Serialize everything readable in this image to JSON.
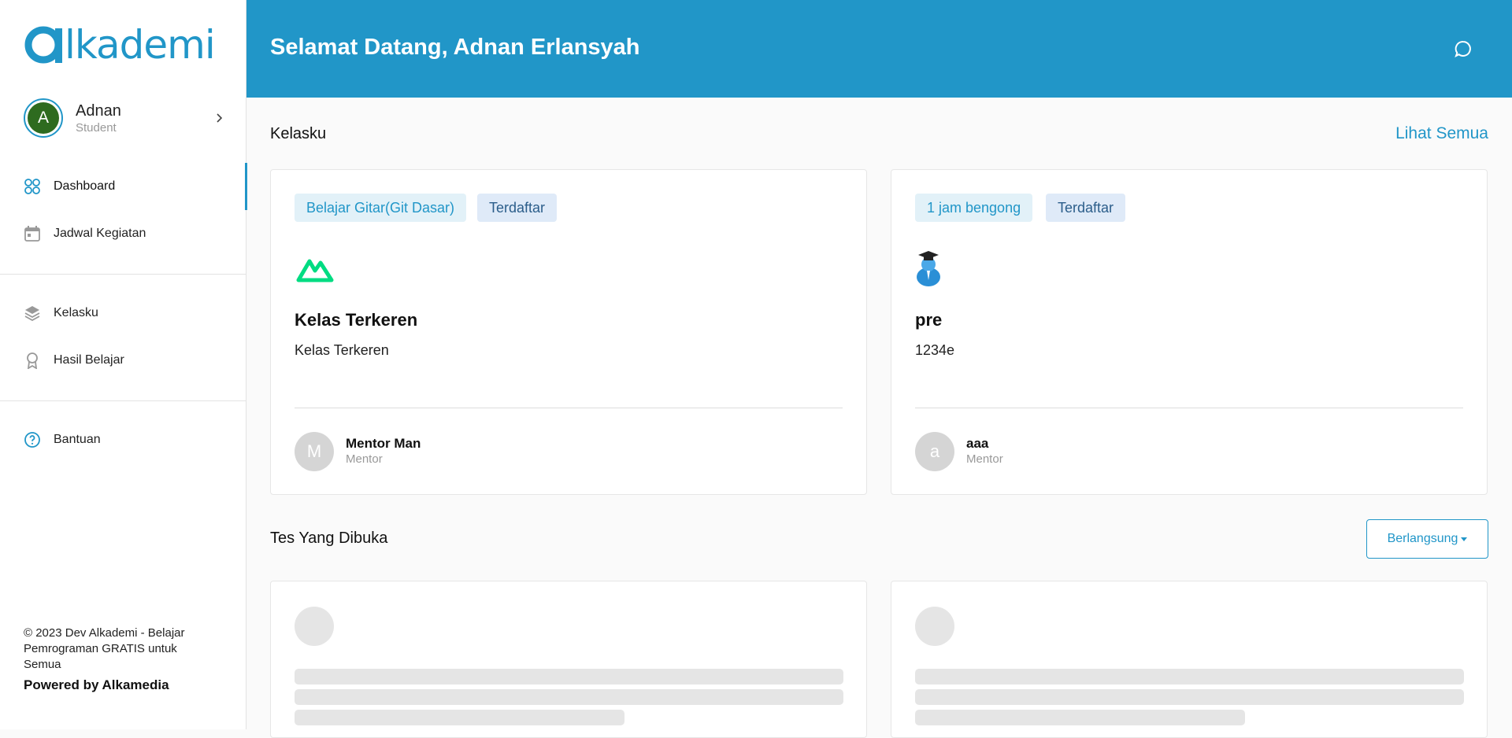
{
  "brand": {
    "logo_text": "lkademi",
    "accent": "#2196c8"
  },
  "user": {
    "initial": "A",
    "name": "Adnan",
    "role": "Student"
  },
  "nav": {
    "dashboard": "Dashboard",
    "schedule": "Jadwal Kegiatan",
    "my_classes": "Kelasku",
    "results": "Hasil Belajar",
    "help": "Bantuan"
  },
  "footer": {
    "copyright": "© 2023 Dev Alkademi - Belajar Pemrograman GRATIS untuk Semua",
    "powered": "Powered by Alkamedia"
  },
  "header": {
    "greeting": "Selamat Datang, Adnan Erlansyah"
  },
  "classes": {
    "title": "Kelasku",
    "see_all": "Lihat Semua",
    "cards": [
      {
        "category": "Belajar Gitar(Git Dasar)",
        "status": "Terdaftar",
        "icon": "nuxt-logo-icon",
        "title": "Kelas Terkeren",
        "desc": "Kelas Terkeren",
        "mentor_initial": "M",
        "mentor_name": "Mentor Man",
        "mentor_role": "Mentor"
      },
      {
        "category": "1 jam bengong",
        "status": "Terdaftar",
        "icon": "graduate-avatar-icon",
        "title": "pre",
        "desc": "1234e",
        "mentor_initial": "a",
        "mentor_name": "aaa",
        "mentor_role": "Mentor"
      }
    ]
  },
  "tests": {
    "title": "Tes Yang Dibuka",
    "filter": "Berlangsung"
  }
}
